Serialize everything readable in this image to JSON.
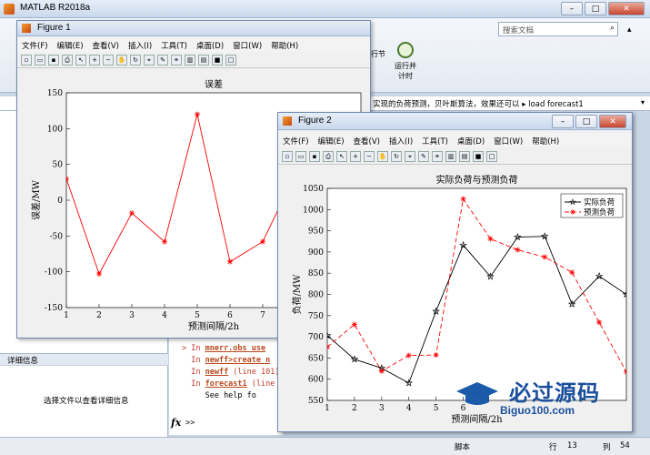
{
  "main": {
    "title": "MATLAB R2018a",
    "search_placeholder": "搜索文档",
    "ribbon_btn1": "行节",
    "ribbon_btn2_line1": "运行并",
    "ribbon_btn2_line2": "计时",
    "address_text": "实现的负荷预测，贝叶斯算法，效果还可以 ▸ load forecast1",
    "detail_title": "详细信息",
    "detail_hint": "选择文件以查看详细信息",
    "cmd": [
      {
        "prefix": "> In ",
        "link": "mnerr.obs_use",
        "rest": ""
      },
      {
        "prefix": "  In ",
        "link": "newff>create_n",
        "rest": ""
      },
      {
        "prefix": "  In ",
        "link": "newff",
        "rest": " (line 101)"
      },
      {
        "prefix": "  In ",
        "link": "forecast1",
        "rest": " (line"
      },
      {
        "prefix": "     ",
        "link": "",
        "rest": "See help fo"
      }
    ],
    "fx_label": "fx",
    "prompt": ">>",
    "status_script": "脚本",
    "status_ln_label": "行",
    "status_ln": "13",
    "status_col_label": "列",
    "status_col": "54"
  },
  "menu": [
    "文件(F)",
    "编辑(E)",
    "查看(V)",
    "插入(I)",
    "工具(T)",
    "桌面(D)",
    "窗口(W)",
    "帮助(H)"
  ],
  "fig1": {
    "title": "Figure 1"
  },
  "fig2": {
    "title": "Figure 2"
  },
  "watermark": {
    "text": "必过源码",
    "sub": "Biguo100.com"
  },
  "chart_data": [
    {
      "type": "line",
      "title": "误差",
      "xlabel": "预测间隔/2h",
      "ylabel": "误差/MW",
      "xlim": [
        1,
        10
      ],
      "ylim": [
        -150,
        150
      ],
      "xticks": [
        1,
        2,
        3,
        4,
        5,
        6,
        7,
        8,
        9
      ],
      "yticks": [
        -150,
        -100,
        -50,
        0,
        50,
        100,
        150
      ],
      "grid": false,
      "series": [
        {
          "name": "",
          "color": "#ff0000",
          "marker": "*",
          "x": [
            1,
            2,
            3,
            4,
            5,
            6,
            7,
            8,
            9,
            10,
            11
          ],
          "y": [
            30,
            -103,
            -18,
            -58,
            120,
            -86,
            -58,
            37,
            35,
            -38,
            143
          ]
        }
      ]
    },
    {
      "type": "line",
      "title": "实际负荷与预测负荷",
      "xlabel": "预测间隔/2h",
      "ylabel": "负荷/MW",
      "xlim": [
        1,
        12
      ],
      "ylim": [
        550,
        1050
      ],
      "xticks": [
        1,
        2,
        3,
        4,
        5,
        6
      ],
      "yticks": [
        550,
        600,
        650,
        700,
        750,
        800,
        850,
        900,
        950,
        1000,
        1050
      ],
      "grid": false,
      "legend": "top-right",
      "series": [
        {
          "name": "实际负荷",
          "color": "#000000",
          "dash": "",
          "marker": "pentagram",
          "x": [
            1,
            2,
            3,
            4,
            5,
            6,
            7,
            8,
            9,
            10,
            11,
            12
          ],
          "y": [
            703,
            647,
            626,
            591,
            760,
            916,
            842,
            935,
            937,
            777,
            843,
            800
          ]
        },
        {
          "name": "预测负荷",
          "color": "#ff0000",
          "dash": "5,3",
          "marker": "*",
          "x": [
            1,
            2,
            3,
            4,
            5,
            6,
            7,
            8,
            9,
            10,
            11,
            12
          ],
          "y": [
            676,
            729,
            619,
            656,
            657,
            1025,
            931,
            905,
            888,
            852,
            734,
            617
          ]
        }
      ]
    }
  ]
}
